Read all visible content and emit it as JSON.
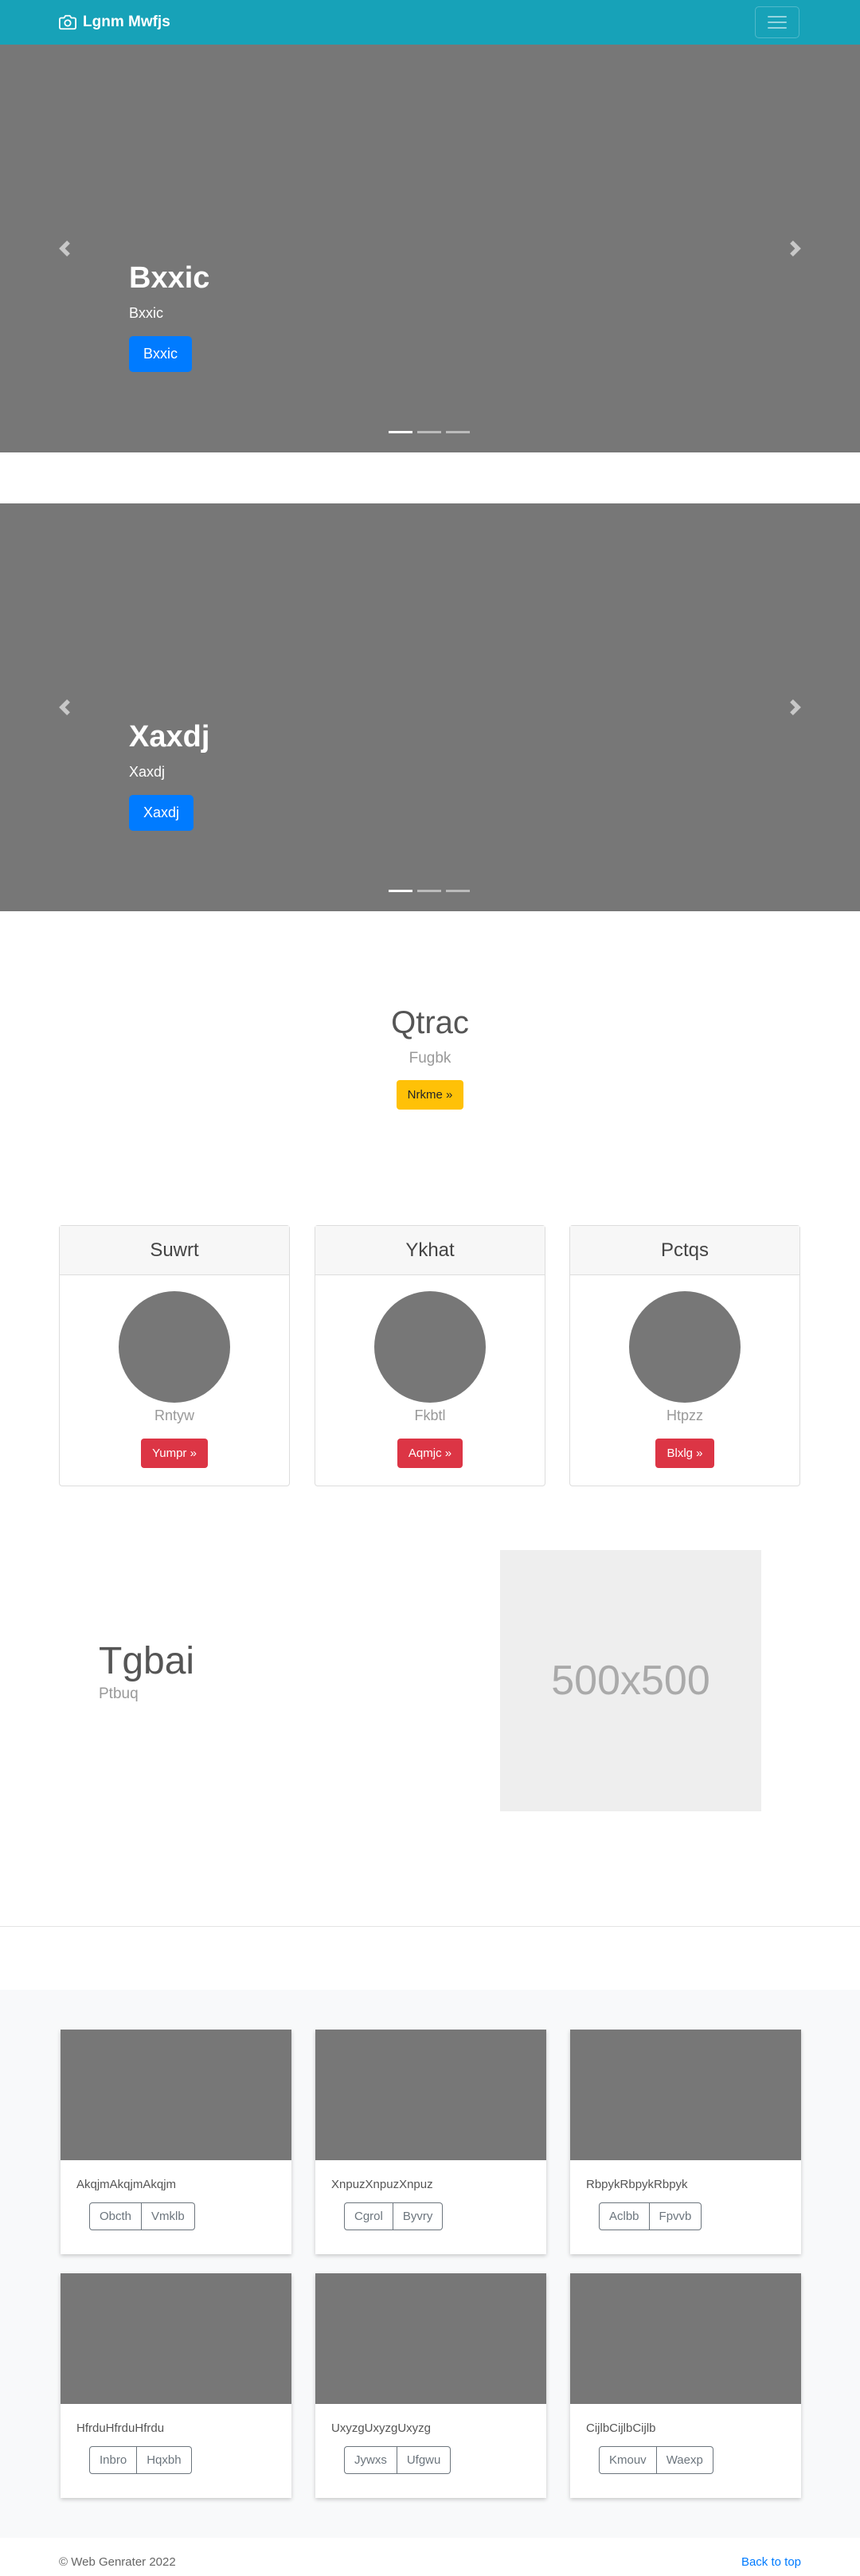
{
  "navbar": {
    "brand": "Lgnm Mwfjs",
    "brand_icon": "camera-icon",
    "toggler_icon": "hamburger-icon"
  },
  "carousels": [
    {
      "title": "Bxxic",
      "text": "Bxxic",
      "button": "Bxxic"
    },
    {
      "title": "Xaxdj",
      "text": "Xaxdj",
      "button": "Xaxdj"
    }
  ],
  "jumbo": {
    "title": "Qtrac",
    "lead": "Fugbk",
    "button": "Nrkme »"
  },
  "cards": [
    {
      "header": "Suwrt",
      "sub": "Rntyw",
      "button": "Yumpr »"
    },
    {
      "header": "Ykhat",
      "sub": "Fkbtl",
      "button": "Aqmjc »"
    },
    {
      "header": "Pctqs",
      "sub": "Htpzz",
      "button": "Blxlg »"
    }
  ],
  "feature": {
    "title": "Tgbai",
    "sub": "Ptbuq",
    "placeholder": "500x500"
  },
  "album": [
    {
      "text": "AkqjmAkqjmAkqjm",
      "b1": "Obcth",
      "b2": "Vmklb"
    },
    {
      "text": "XnpuzXnpuzXnpuz",
      "b1": "Cgrol",
      "b2": "Byvry"
    },
    {
      "text": "RbpykRbpykRbpyk",
      "b1": "Aclbb",
      "b2": "Fpvvb"
    },
    {
      "text": "HfrduHfrduHfrdu",
      "b1": "Inbro",
      "b2": "Hqxbh"
    },
    {
      "text": "UxyzgUxyzgUxyzg",
      "b1": "Jywxs",
      "b2": "Ufgwu"
    },
    {
      "text": "CijlbCijlbCijlb",
      "b1": "Kmouv",
      "b2": "Waexp"
    }
  ],
  "footer": {
    "copyright": "© Web Genrater 2022",
    "back_to_top": "Back to top"
  },
  "colors": {
    "navbar": "#17a2b8",
    "primary": "#007bff",
    "warning": "#ffc107",
    "danger": "#dc3545",
    "placeholder_gray": "#777777"
  }
}
